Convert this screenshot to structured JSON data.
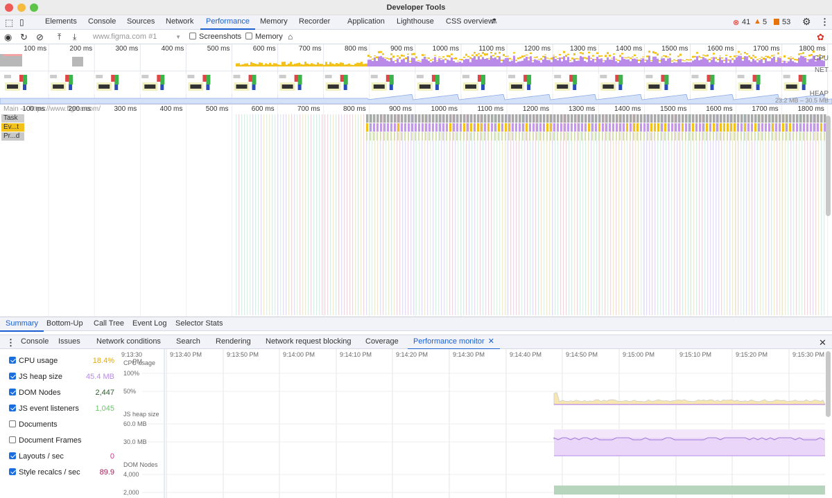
{
  "window": {
    "title": "Developer Tools"
  },
  "tabs": [
    "Elements",
    "Console",
    "Sources",
    "Network",
    "Performance",
    "Memory",
    "Recorder",
    "Application",
    "Lighthouse",
    "CSS overview"
  ],
  "active_tab": "Performance",
  "status": {
    "errors": "41",
    "warnings": "5",
    "issues": "53"
  },
  "toolbar": {
    "recording_select": "www.figma.com #1",
    "screenshots_label": "Screenshots",
    "screenshots_checked": false,
    "memory_label": "Memory",
    "memory_checked": false
  },
  "overview": {
    "ticks": [
      "100 ms",
      "200 ms",
      "300 ms",
      "400 ms",
      "500 ms",
      "600 ms",
      "700 ms",
      "800 ms",
      "900 ms",
      "1000 ms",
      "1100 ms",
      "1200 ms",
      "1300 ms",
      "1400 ms",
      "1500 ms",
      "1600 ms",
      "1700 ms",
      "1800 ms"
    ],
    "cpu_label": "CPU",
    "net_label": "NET",
    "heap_label": "HEAP",
    "heap_range": "23.2 MB – 30.5 MB"
  },
  "flame": {
    "main_label": "Main — https://www.figma.com/",
    "tracks": [
      "Task",
      "Ev...t",
      "Pr...d"
    ]
  },
  "bottom_tabs": [
    "Summary",
    "Bottom-Up",
    "Call Tree",
    "Event Log",
    "Selector Stats"
  ],
  "drawer_tabs": [
    "Console",
    "Issues",
    "Network conditions",
    "Search",
    "Rendering",
    "Network request blocking",
    "Coverage",
    "Performance monitor"
  ],
  "active_drawer_tab": "Performance monitor",
  "metrics": [
    {
      "label": "CPU usage",
      "value": "18.4%",
      "checked": true,
      "color": "#e8a900"
    },
    {
      "label": "JS heap size",
      "value": "45.4 MB",
      "checked": true,
      "color": "#b98ae8"
    },
    {
      "label": "DOM Nodes",
      "value": "2,447",
      "checked": true,
      "color": "#2d5b2d"
    },
    {
      "label": "JS event listeners",
      "value": "1,045",
      "checked": true,
      "color": "#6cc46c"
    },
    {
      "label": "Documents",
      "value": "",
      "checked": false,
      "color": ""
    },
    {
      "label": "Document Frames",
      "value": "",
      "checked": false,
      "color": ""
    },
    {
      "label": "Layouts / sec",
      "value": "0",
      "checked": true,
      "color": "#e0308a"
    },
    {
      "label": "Style recalcs / sec",
      "value": "89.9",
      "checked": true,
      "color": "#a0205a"
    }
  ],
  "monitor": {
    "times": [
      "9:13:30 PM",
      "9:13:40 PM",
      "9:13:50 PM",
      "9:14:00 PM",
      "9:14:10 PM",
      "9:14:20 PM",
      "9:14:30 PM",
      "9:14:40 PM",
      "9:14:50 PM",
      "9:15:00 PM",
      "9:15:10 PM",
      "9:15:20 PM",
      "9:15:30 PM"
    ],
    "cpu_title": "CPU usage",
    "cpu_ticks": [
      "100%",
      "50%"
    ],
    "heap_title": "JS heap size",
    "heap_ticks": [
      "60.0 MB",
      "30.0 MB"
    ],
    "dom_title": "DOM Nodes",
    "dom_ticks": [
      "4,000",
      "2,000"
    ]
  }
}
